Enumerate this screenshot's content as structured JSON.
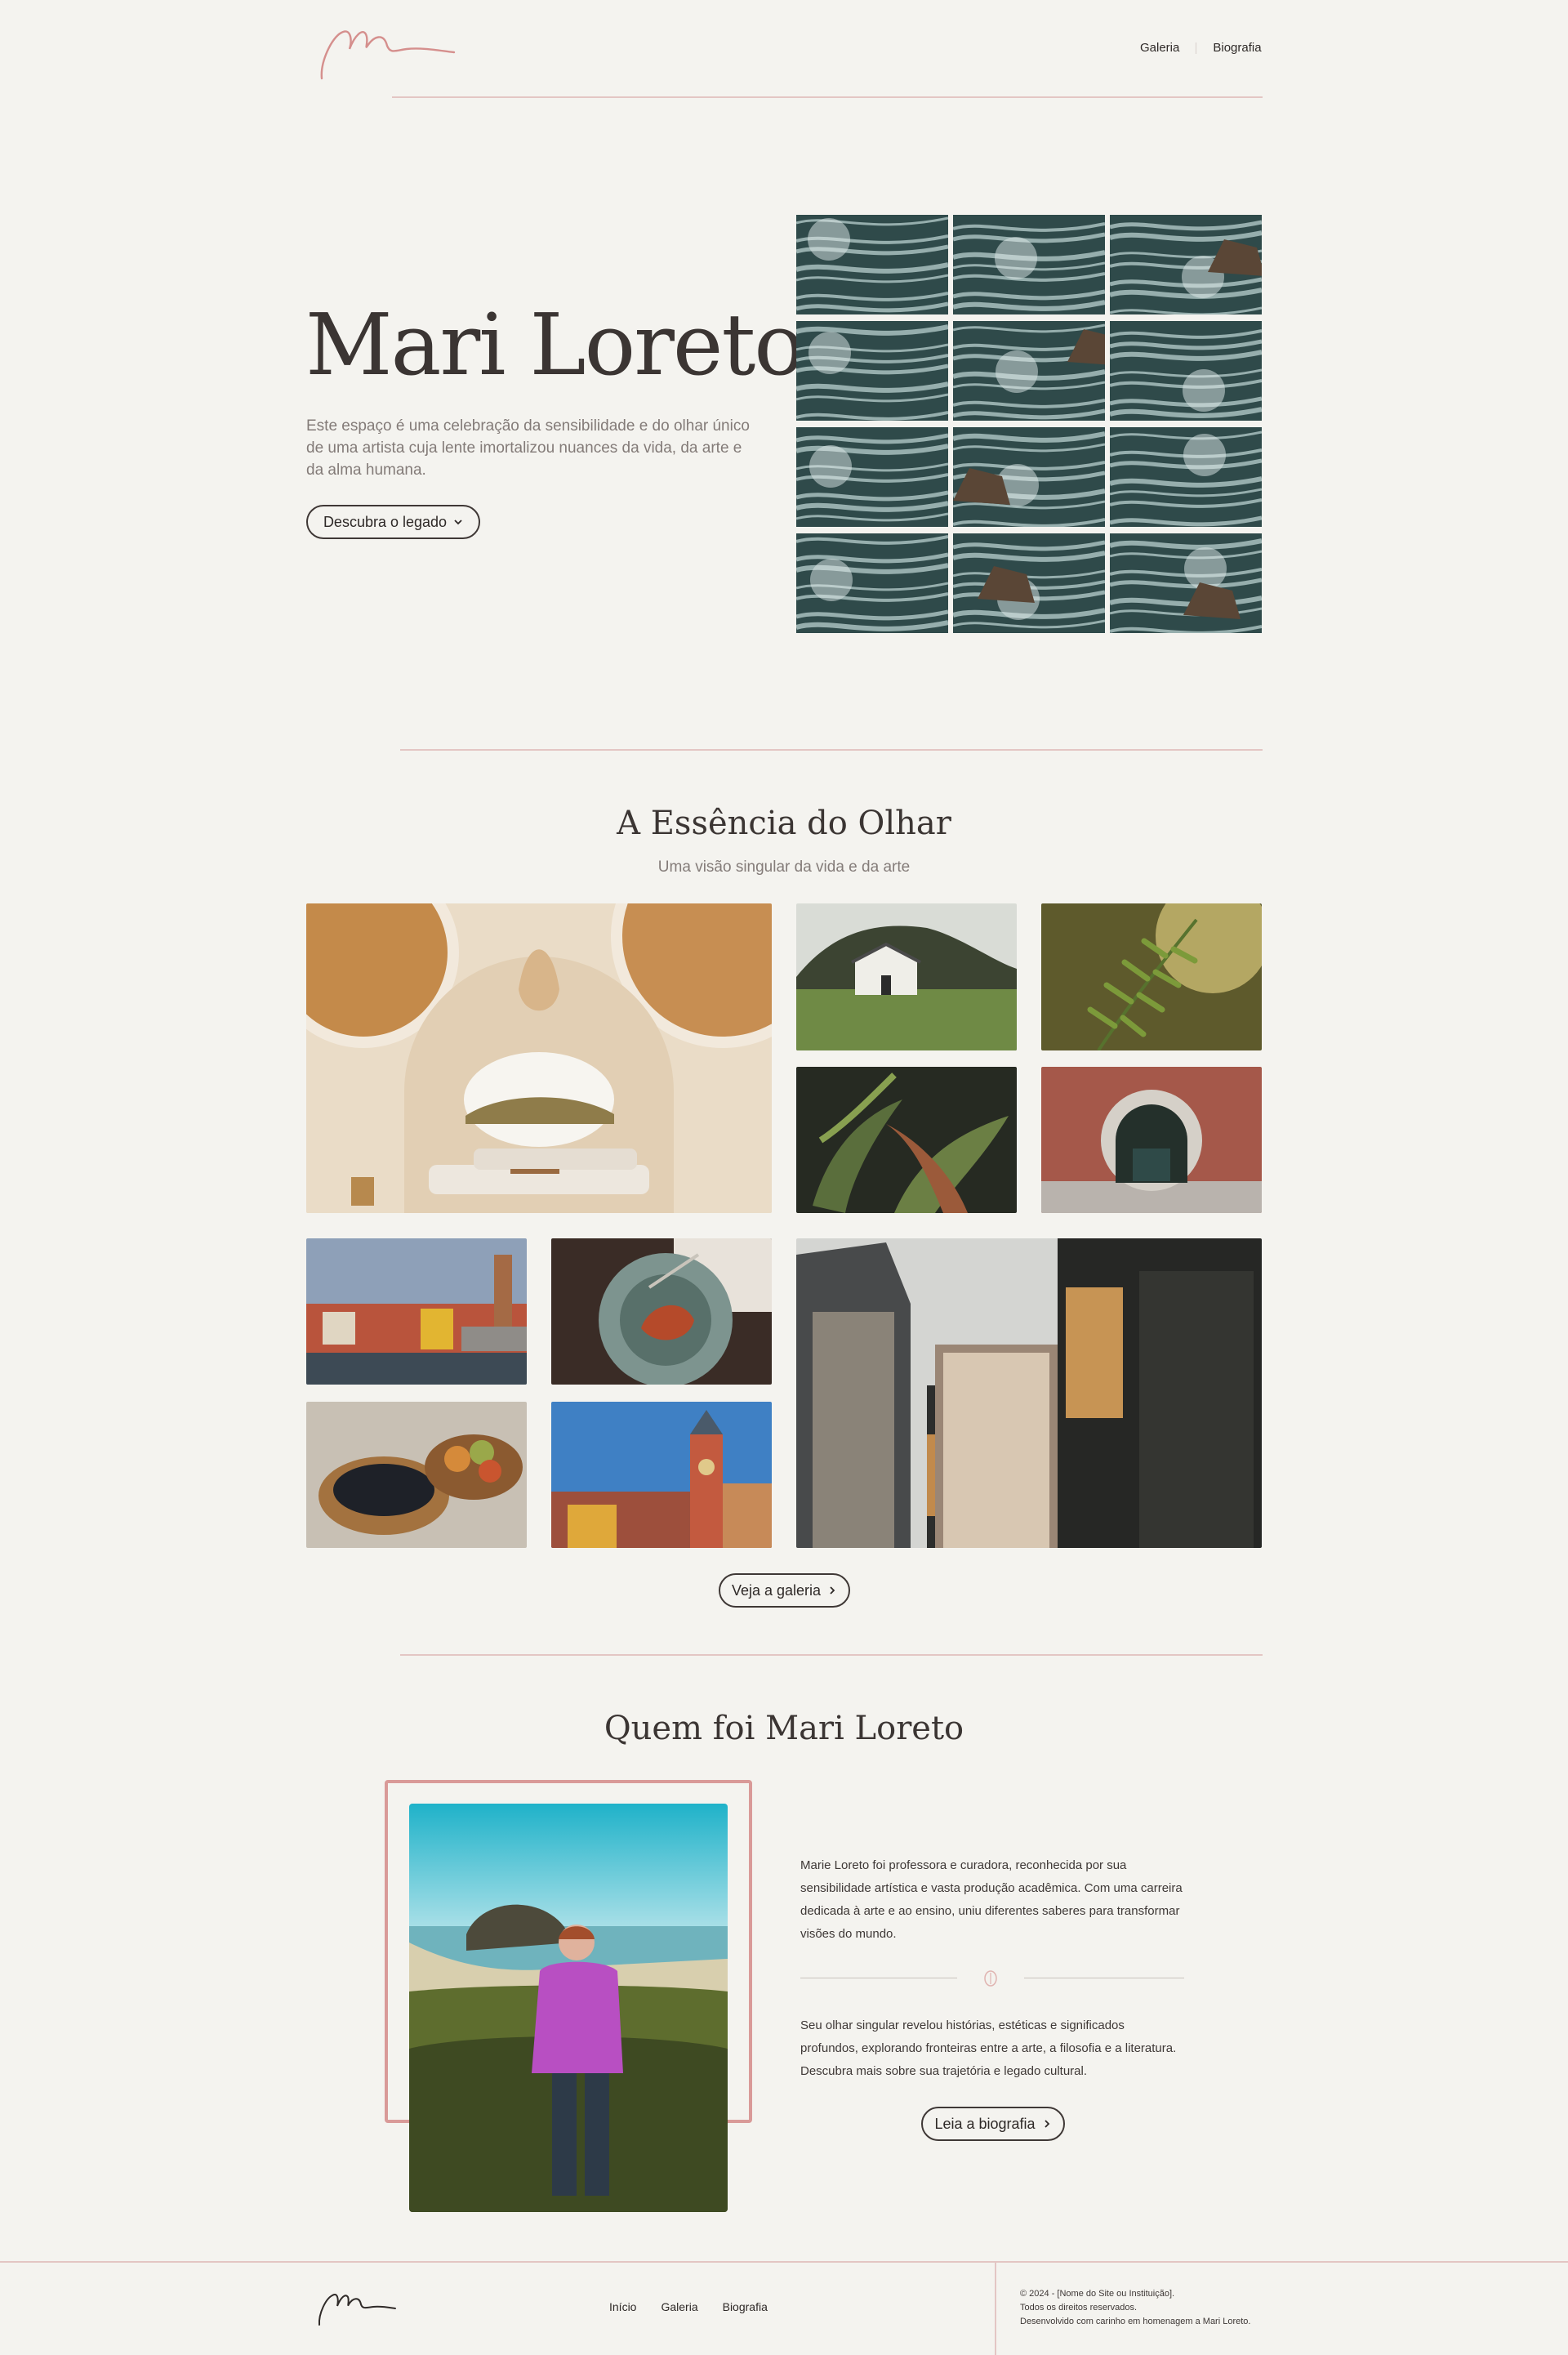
{
  "header": {
    "nav": [
      "Galeria",
      "Biografia"
    ]
  },
  "hero": {
    "title": "Mari Loreto",
    "description": "Este espaço é uma celebração da sensibilidade e do olhar único de uma artista cuja lente imortalizou nuances da vida, da arte e da alma humana.",
    "cta_label": "Descubra o legado"
  },
  "essence": {
    "title": "A Essência do Olhar",
    "subtitle": "Uma visão singular da vida e da arte",
    "cta_label": "Veja a galeria"
  },
  "bio": {
    "title": "Quem foi Mari Loreto",
    "paragraph1": "Marie Loreto foi professora e curadora, reconhecida por sua sensibilidade artística e vasta produção acadêmica. Com uma carreira dedicada à arte e ao ensino, uniu diferentes saberes para transformar visões do mundo.",
    "paragraph2": "Seu olhar singular revelou histórias, estéticas e significados profundos, explorando fronteiras entre a arte, a filosofia e a literatura. Descubra mais sobre sua trajetória e legado cultural.",
    "cta_label": "Leia a biografia"
  },
  "footer": {
    "nav": [
      "Início",
      "Galeria",
      "Biografia"
    ],
    "copyright": "© 2024 - [Nome do Site ou Instituição].",
    "rights": "Todos os direitos reservados.",
    "tribute": "Desenvolvido com carinho em homenagem a Mari Loreto."
  },
  "colors": {
    "background": "#f4f3ef",
    "accent": "#d99a98",
    "text": "#3b3533"
  }
}
